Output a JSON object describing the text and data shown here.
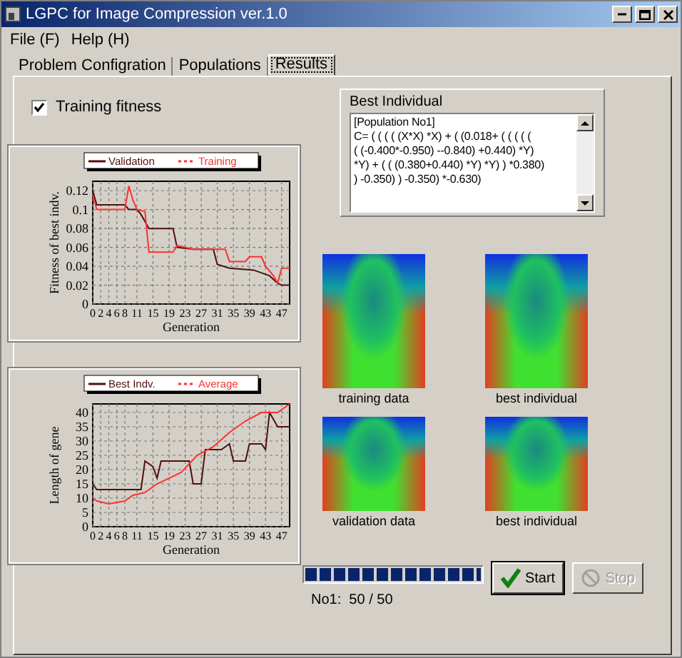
{
  "window": {
    "title": "LGPC for Image Compression ver.1.0"
  },
  "menu": [
    {
      "label": "File (F)"
    },
    {
      "label": "Help (H)"
    }
  ],
  "tabs": [
    {
      "label": "Problem Configration",
      "selected": false
    },
    {
      "label": "Populations",
      "selected": false
    },
    {
      "label": "Results",
      "selected": true
    }
  ],
  "training_fitness": {
    "label": "Training fitness",
    "checked": true
  },
  "charts": [
    {
      "chart_data": {
        "type": "line",
        "grid": true,
        "legend": "top",
        "xlabel": "Generation",
        "ylabel": "Fitness of best indv.",
        "xlim": [
          0,
          49
        ],
        "ylim": [
          0,
          0.13
        ],
        "xticks": [
          0,
          2,
          4,
          6,
          8,
          11,
          15,
          19,
          23,
          27,
          31,
          35,
          39,
          43,
          47
        ],
        "yticks": [
          0,
          0.02,
          0.04,
          0.06,
          0.08,
          0.1,
          0.12
        ],
        "series": [
          {
            "name": "Validation",
            "color": "#501010",
            "x": [
              0,
              1,
              8,
              9,
              11,
              12,
              14,
              20,
              21,
              25,
              30,
              31,
              34,
              40,
              44,
              46,
              47,
              49
            ],
            "values": [
              0.12,
              0.105,
              0.105,
              0.1,
              0.1,
              0.095,
              0.08,
              0.08,
              0.06,
              0.058,
              0.058,
              0.042,
              0.038,
              0.036,
              0.03,
              0.022,
              0.02,
              0.02
            ]
          },
          {
            "name": "Training",
            "color": "#ff3030",
            "x": [
              0,
              1,
              8,
              9,
              10,
              11,
              13,
              14,
              20,
              21,
              25,
              33,
              34,
              38,
              39,
              42,
              43,
              45,
              46,
              47,
              49
            ],
            "values": [
              0.115,
              0.1,
              0.1,
              0.125,
              0.11,
              0.1,
              0.098,
              0.055,
              0.055,
              0.062,
              0.058,
              0.058,
              0.045,
              0.045,
              0.05,
              0.05,
              0.04,
              0.03,
              0.022,
              0.038,
              0.038
            ]
          }
        ]
      }
    },
    {
      "chart_data": {
        "type": "line",
        "grid": true,
        "legend": "top",
        "xlabel": "Generation",
        "ylabel": "Length of gene",
        "xlim": [
          0,
          49
        ],
        "ylim": [
          0,
          43
        ],
        "xticks": [
          0,
          2,
          4,
          6,
          8,
          11,
          15,
          19,
          23,
          27,
          31,
          35,
          39,
          43,
          47
        ],
        "yticks": [
          0,
          5,
          10,
          15,
          20,
          25,
          30,
          35,
          40
        ],
        "series": [
          {
            "name": "Best Indv.",
            "color": "#501010",
            "x": [
              0,
              1,
              12,
              13,
              15,
              16,
              17,
              24,
              25,
              27,
              28,
              32,
              34,
              35,
              38,
              39,
              42,
              43,
              44,
              46,
              49
            ],
            "values": [
              15,
              13,
              13,
              23,
              21,
              17,
              23,
              23,
              15,
              15,
              27,
              27,
              29,
              23,
              23,
              29,
              29,
              27,
              40,
              35,
              35
            ]
          },
          {
            "name": "Average",
            "color": "#ff3030",
            "x": [
              0,
              1,
              4,
              8,
              10,
              13,
              16,
              22,
              26,
              30,
              34,
              38,
              42,
              46,
              49
            ],
            "values": [
              10,
              9,
              8,
              9,
              11,
              12,
              15,
              19,
              25,
              28,
              33,
              37,
              40,
              40,
              43
            ]
          }
        ]
      }
    }
  ],
  "best_individual": {
    "title": "Best Individual",
    "lines": [
      "[Population No1]",
      "C= ( ( ( ( (X*X) *X) + ( (0.018+ ( ( ( ( (",
      "( (-0.400*-0.950) --0.840) +0.440) *Y)",
      "*Y) + ( ( (0.380+0.440) *Y) *Y) ) *0.380)",
      ") -0.350) ) -0.350) *-0.630)"
    ]
  },
  "images": [
    {
      "caption": "training data"
    },
    {
      "caption": "best individual"
    },
    {
      "caption": "validation data"
    },
    {
      "caption": "best individual"
    }
  ],
  "progress": {
    "level": 1,
    "caption": "No1:  50 / 50"
  },
  "buttons": [
    {
      "kind": "start",
      "label": "Start",
      "disabled": false
    },
    {
      "kind": "stop",
      "label": "Stop",
      "disabled": true
    }
  ]
}
